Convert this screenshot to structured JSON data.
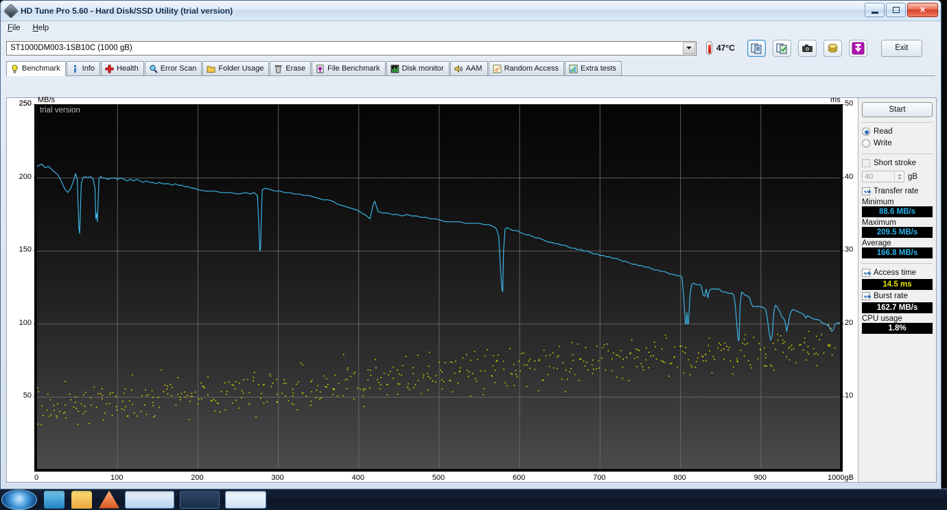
{
  "window": {
    "title": "HD Tune Pro 5.60 - Hard Disk/SSD Utility (trial version)",
    "icon": "hdtune-icon",
    "minimize": "minimize-button",
    "maximize": "maximize-button",
    "close": "close-button"
  },
  "menu": {
    "items": [
      {
        "label": "File"
      },
      {
        "label": "Help"
      }
    ]
  },
  "toolbar": {
    "drive": "ST1000DM003-1SB10C (1000 gB)",
    "temperature": "47°C",
    "exit_label": "Exit",
    "buttons": [
      {
        "name": "copy-log-button",
        "icon": "documents-icon"
      },
      {
        "name": "save-report-button",
        "icon": "document-check-icon"
      },
      {
        "name": "screenshot-button",
        "icon": "camera-icon"
      },
      {
        "name": "options-button",
        "icon": "coins-icon"
      },
      {
        "name": "download-button",
        "icon": "down-arrow-icon"
      }
    ]
  },
  "tabs": [
    {
      "label": "Benchmark",
      "icon": "lightbulb-icon",
      "selected": true
    },
    {
      "label": "Info",
      "icon": "info-icon",
      "selected": false
    },
    {
      "label": "Health",
      "icon": "red-cross-icon",
      "selected": false
    },
    {
      "label": "Error Scan",
      "icon": "magnifier-icon",
      "selected": false
    },
    {
      "label": "Folder Usage",
      "icon": "folder-icon",
      "selected": false
    },
    {
      "label": "Erase",
      "icon": "trash-icon",
      "selected": false
    },
    {
      "label": "File Benchmark",
      "icon": "file-disk-icon",
      "selected": false
    },
    {
      "label": "Disk monitor",
      "icon": "bar-chart-icon",
      "selected": false
    },
    {
      "label": "AAM",
      "icon": "speaker-icon",
      "selected": false
    },
    {
      "label": "Random Access",
      "icon": "scatter-icon",
      "selected": false
    },
    {
      "label": "Extra tests",
      "icon": "grid-chart-icon",
      "selected": false
    }
  ],
  "sidebar": {
    "start_label": "Start",
    "mode": [
      {
        "label": "Read",
        "selected": true
      },
      {
        "label": "Write",
        "selected": false
      }
    ],
    "short_stroke": {
      "label": "Short stroke",
      "checked": false,
      "value": "40",
      "unit": "gB"
    },
    "transfer_rate": {
      "label": "Transfer rate",
      "checked": true
    },
    "minimum_label": "Minimum",
    "minimum_value": "88.6 MB/s",
    "maximum_label": "Maximum",
    "maximum_value": "209.5 MB/s",
    "average_label": "Average",
    "average_value": "166.8 MB/s",
    "access_time": {
      "label": "Access time",
      "checked": true,
      "value": "14.5 ms"
    },
    "burst_rate": {
      "label": "Burst rate",
      "checked": true,
      "value": "162.7 MB/s"
    },
    "cpu_usage_label": "CPU usage",
    "cpu_usage_value": "1.8%"
  },
  "chart_data": {
    "type": "line",
    "title": "",
    "watermark": "trial version",
    "xlabel": "gB",
    "ylabel": "MB/s",
    "y2label": "ms",
    "xlim": [
      0,
      1000
    ],
    "ylim": [
      0,
      250
    ],
    "y2lim": [
      0,
      50
    ],
    "xticks": [
      0,
      100,
      200,
      300,
      400,
      500,
      600,
      700,
      800,
      900,
      1000
    ],
    "xticklabels": [
      "0",
      "100",
      "200",
      "300",
      "400",
      "500",
      "600",
      "700",
      "800",
      "900",
      "1000gB"
    ],
    "yticks": [
      50,
      100,
      150,
      200,
      250
    ],
    "y2ticks": [
      10,
      20,
      30,
      40,
      50
    ],
    "grid": true,
    "colors": {
      "transfer_rate": "#3cb4e5",
      "access_time": "#d8d800",
      "plot_bg": "#101010"
    },
    "series": [
      {
        "name": "Transfer rate",
        "unit": "MB/s",
        "color": "#3cb4e5",
        "axis": "left",
        "points": [
          [
            0,
            208
          ],
          [
            6,
            209.5
          ],
          [
            10,
            207
          ],
          [
            14,
            208
          ],
          [
            18,
            206
          ],
          [
            22,
            204
          ],
          [
            26,
            202
          ],
          [
            30,
            198
          ],
          [
            34,
            193
          ],
          [
            38,
            190
          ],
          [
            42,
            193
          ],
          [
            46,
            199
          ],
          [
            48,
            203
          ],
          [
            50,
            199
          ],
          [
            52,
            166
          ],
          [
            53,
            162
          ],
          [
            55,
            196
          ],
          [
            57,
            200
          ],
          [
            60,
            201
          ],
          [
            63,
            200
          ],
          [
            66,
            201
          ],
          [
            68,
            200
          ],
          [
            70,
            199
          ],
          [
            72,
            193
          ],
          [
            73,
            172
          ],
          [
            74,
            176
          ],
          [
            75,
            170
          ],
          [
            77,
            199
          ],
          [
            79,
            201
          ],
          [
            81,
            200
          ],
          [
            84,
            200
          ],
          [
            88,
            199
          ],
          [
            92,
            200
          ],
          [
            96,
            200
          ],
          [
            100,
            199
          ],
          [
            104,
            200
          ],
          [
            108,
            199
          ],
          [
            112,
            198
          ],
          [
            116,
            199
          ],
          [
            120,
            198
          ],
          [
            124,
            199
          ],
          [
            128,
            198
          ],
          [
            132,
            197
          ],
          [
            136,
            198
          ],
          [
            140,
            197
          ],
          [
            144,
            197
          ],
          [
            148,
            196
          ],
          [
            152,
            197
          ],
          [
            156,
            196
          ],
          [
            160,
            196
          ],
          [
            164,
            196
          ],
          [
            168,
            195
          ],
          [
            172,
            196
          ],
          [
            176,
            195
          ],
          [
            180,
            195
          ],
          [
            184,
            194
          ],
          [
            188,
            194
          ],
          [
            192,
            193
          ],
          [
            196,
            193
          ],
          [
            200,
            192
          ],
          [
            210,
            191
          ],
          [
            220,
            191
          ],
          [
            230,
            190
          ],
          [
            240,
            190
          ],
          [
            250,
            189
          ],
          [
            260,
            190
          ],
          [
            265,
            189
          ],
          [
            270,
            190
          ],
          [
            274,
            188
          ],
          [
            276,
            165
          ],
          [
            277,
            150
          ],
          [
            278,
            152
          ],
          [
            279,
            176
          ],
          [
            280,
            192
          ],
          [
            284,
            193
          ],
          [
            290,
            192
          ],
          [
            296,
            191
          ],
          [
            302,
            191
          ],
          [
            308,
            190
          ],
          [
            314,
            190
          ],
          [
            320,
            189
          ],
          [
            326,
            189
          ],
          [
            332,
            188
          ],
          [
            338,
            188
          ],
          [
            344,
            187
          ],
          [
            350,
            186
          ],
          [
            356,
            185
          ],
          [
            362,
            185
          ],
          [
            368,
            184
          ],
          [
            374,
            182
          ],
          [
            380,
            181
          ],
          [
            386,
            180
          ],
          [
            392,
            179
          ],
          [
            398,
            178
          ],
          [
            404,
            176
          ],
          [
            410,
            174
          ],
          [
            414,
            172
          ],
          [
            418,
            182
          ],
          [
            420,
            184
          ],
          [
            424,
            177
          ],
          [
            430,
            176
          ],
          [
            436,
            176
          ],
          [
            442,
            175
          ],
          [
            448,
            175
          ],
          [
            454,
            174
          ],
          [
            460,
            175
          ],
          [
            466,
            174
          ],
          [
            472,
            174
          ],
          [
            478,
            173
          ],
          [
            484,
            173
          ],
          [
            490,
            172
          ],
          [
            496,
            172
          ],
          [
            502,
            171
          ],
          [
            508,
            170
          ],
          [
            514,
            170
          ],
          [
            520,
            170
          ],
          [
            526,
            170
          ],
          [
            532,
            169
          ],
          [
            538,
            169
          ],
          [
            544,
            169
          ],
          [
            550,
            169
          ],
          [
            556,
            168
          ],
          [
            562,
            168
          ],
          [
            566,
            167
          ],
          [
            570,
            166
          ],
          [
            572,
            164
          ],
          [
            574,
            160
          ],
          [
            576,
            140
          ],
          [
            578,
            124
          ],
          [
            579,
            122
          ],
          [
            580,
            150
          ],
          [
            582,
            165
          ],
          [
            584,
            166
          ],
          [
            588,
            165
          ],
          [
            592,
            164
          ],
          [
            596,
            164
          ],
          [
            600,
            163
          ],
          [
            604,
            162
          ],
          [
            608,
            161
          ],
          [
            612,
            161
          ],
          [
            616,
            160
          ],
          [
            620,
            159
          ],
          [
            624,
            159
          ],
          [
            628,
            158
          ],
          [
            632,
            157
          ],
          [
            636,
            156
          ],
          [
            640,
            156
          ],
          [
            644,
            155
          ],
          [
            648,
            155
          ],
          [
            652,
            154
          ],
          [
            656,
            154
          ],
          [
            660,
            153
          ],
          [
            664,
            152
          ],
          [
            668,
            152
          ],
          [
            672,
            151
          ],
          [
            676,
            151
          ],
          [
            680,
            150
          ],
          [
            684,
            150
          ],
          [
            688,
            149
          ],
          [
            692,
            148
          ],
          [
            696,
            148
          ],
          [
            700,
            147
          ],
          [
            704,
            147
          ],
          [
            708,
            146
          ],
          [
            712,
            146
          ],
          [
            716,
            145
          ],
          [
            720,
            145
          ],
          [
            724,
            144
          ],
          [
            728,
            143
          ],
          [
            732,
            143
          ],
          [
            736,
            142
          ],
          [
            740,
            141
          ],
          [
            744,
            141
          ],
          [
            748,
            140
          ],
          [
            752,
            140
          ],
          [
            756,
            139
          ],
          [
            760,
            139
          ],
          [
            764,
            138
          ],
          [
            768,
            137
          ],
          [
            772,
            137
          ],
          [
            776,
            136
          ],
          [
            780,
            136
          ],
          [
            784,
            135
          ],
          [
            788,
            134
          ],
          [
            792,
            134
          ],
          [
            796,
            133
          ],
          [
            800,
            133
          ],
          [
            802,
            132
          ],
          [
            804,
            118
          ],
          [
            806,
            101
          ],
          [
            807,
            100
          ],
          [
            808,
            108
          ],
          [
            809,
            100
          ],
          [
            810,
            101
          ],
          [
            812,
            121
          ],
          [
            814,
            127
          ],
          [
            816,
            128
          ],
          [
            820,
            127
          ],
          [
            824,
            127
          ],
          [
            826,
            126
          ],
          [
            828,
            120
          ],
          [
            830,
            119
          ],
          [
            832,
            124
          ],
          [
            834,
            118
          ],
          [
            836,
            123
          ],
          [
            838,
            124
          ],
          [
            840,
            124
          ],
          [
            844,
            124
          ],
          [
            848,
            124
          ],
          [
            850,
            123
          ],
          [
            852,
            122
          ],
          [
            856,
            122
          ],
          [
            860,
            121
          ],
          [
            864,
            121
          ],
          [
            866,
            120
          ],
          [
            868,
            114
          ],
          [
            870,
            100
          ],
          [
            872,
            88.6
          ],
          [
            873,
            90
          ],
          [
            874,
            112
          ],
          [
            876,
            122
          ],
          [
            878,
            121
          ],
          [
            880,
            120
          ],
          [
            884,
            119
          ],
          [
            886,
            118
          ],
          [
            888,
            114
          ],
          [
            890,
            112
          ],
          [
            892,
            112
          ],
          [
            896,
            112
          ],
          [
            900,
            112
          ],
          [
            904,
            111
          ],
          [
            906,
            110
          ],
          [
            908,
            104
          ],
          [
            910,
            95
          ],
          [
            912,
            89
          ],
          [
            914,
            92
          ],
          [
            916,
            108
          ],
          [
            918,
            113
          ],
          [
            920,
            112
          ],
          [
            922,
            110
          ],
          [
            924,
            108
          ],
          [
            926,
            105
          ],
          [
            928,
            104
          ],
          [
            930,
            102
          ],
          [
            932,
            95
          ],
          [
            934,
            100
          ],
          [
            936,
            106
          ],
          [
            938,
            109
          ],
          [
            940,
            110
          ],
          [
            944,
            109
          ],
          [
            948,
            108
          ],
          [
            952,
            107
          ],
          [
            954,
            106
          ],
          [
            956,
            104
          ],
          [
            958,
            106
          ],
          [
            960,
            105
          ],
          [
            964,
            104
          ],
          [
            968,
            103
          ],
          [
            972,
            103
          ],
          [
            976,
            101
          ],
          [
            980,
            100
          ],
          [
            984,
            99
          ],
          [
            986,
            97
          ],
          [
            988,
            95
          ],
          [
            990,
            96
          ],
          [
            992,
            100
          ],
          [
            996,
            101
          ],
          [
            1000,
            100
          ]
        ]
      },
      {
        "name": "Access time",
        "unit": "ms",
        "color": "#d8d800",
        "axis": "right",
        "description": "Scatter of random access times, rising band from about 6-16 ms at 0 gB to about 14-21 ms at 1000 gB",
        "band": {
          "start_low": 4.0,
          "start_high": 13.0,
          "end_low": 13.5,
          "end_high": 21.5,
          "count": 560
        }
      }
    ]
  }
}
